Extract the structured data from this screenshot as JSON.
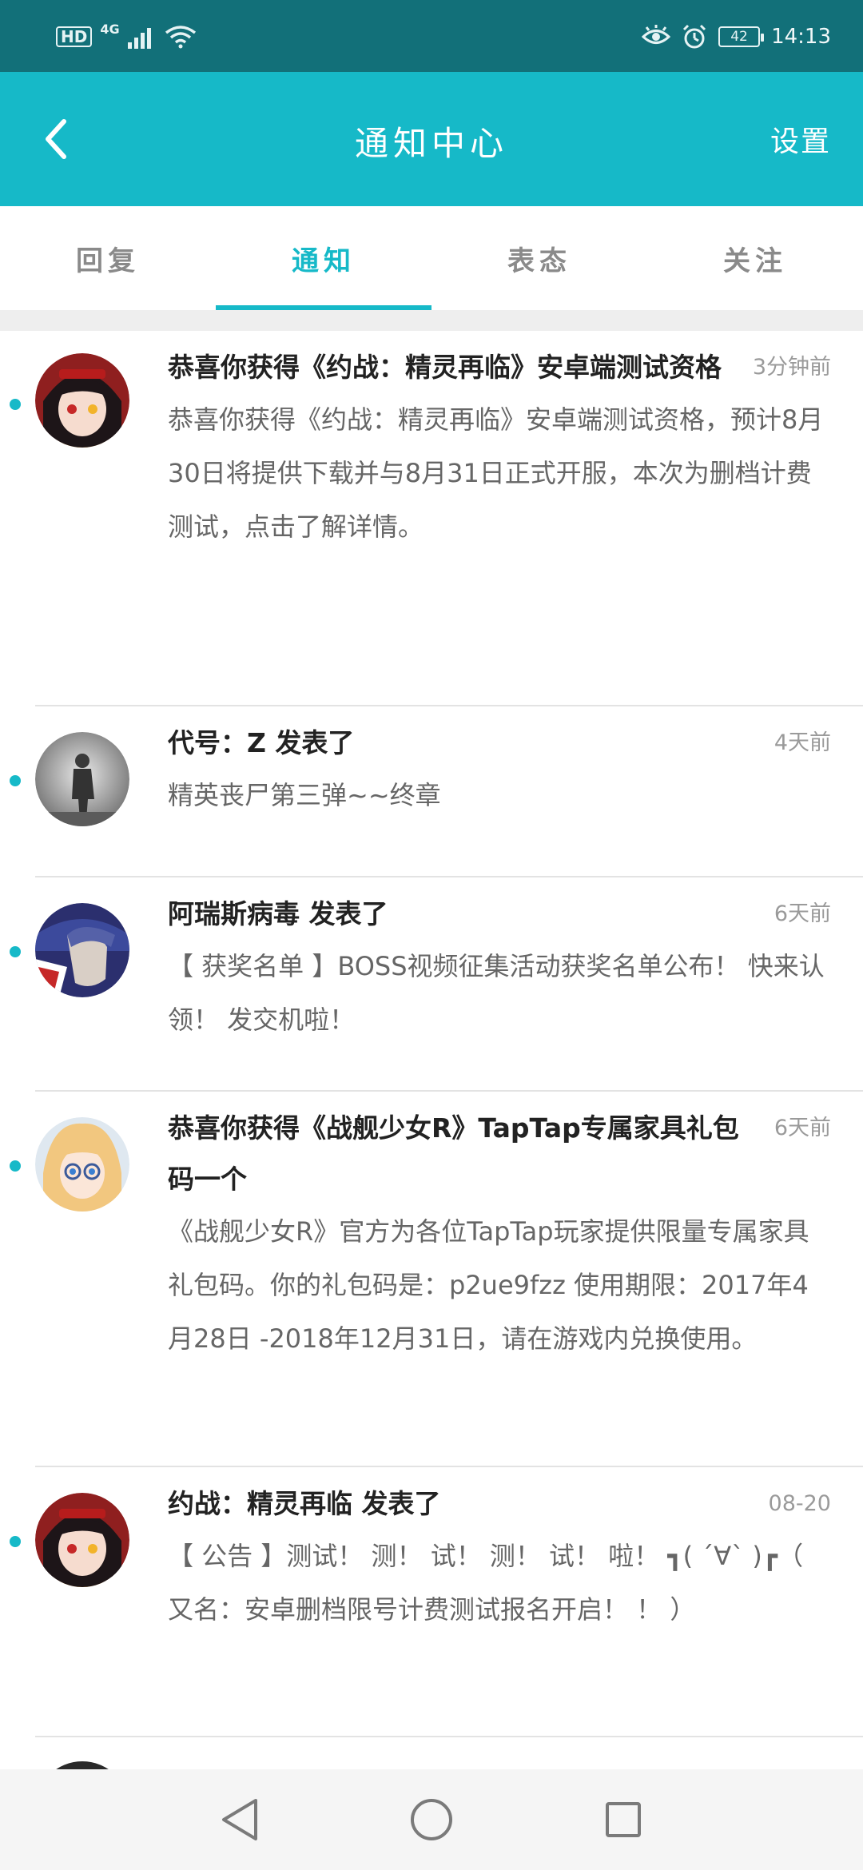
{
  "status_bar": {
    "hd": "HD",
    "network": "4G",
    "battery": "42",
    "time": "14:13"
  },
  "header": {
    "title": "通知中心",
    "settings": "设置"
  },
  "tabs": [
    {
      "label": "回复",
      "active": false
    },
    {
      "label": "通知",
      "active": true
    },
    {
      "label": "表态",
      "active": false
    },
    {
      "label": "关注",
      "active": false
    }
  ],
  "notifications": [
    {
      "title": "恭喜你获得《约战：精灵再临》安卓端测试资格",
      "time": "3分钟前",
      "body": "恭喜你获得《约战：精灵再临》安卓端测试资格，预计8月30日将提供下载并与8月31日正式开服，本次为删档计费测试，点击了解详情。",
      "avatar": "anime-girl-avatar"
    },
    {
      "title": "代号：Z 发表了",
      "time": "4天前",
      "body": "精英丧尸第三弹~~终章",
      "avatar": "zombie-figure-avatar"
    },
    {
      "title": "阿瑞斯病毒 发表了",
      "time": "6天前",
      "body": "【 获奖名单 】BOSS视频征集活动获奖名单公布！ 快来认领！ 发交机啦！",
      "avatar": "soldier-avatar"
    },
    {
      "title": "恭喜你获得《战舰少女R》TapTap专属家具礼包码一个",
      "time": "6天前",
      "body": "《战舰少女R》官方为各位TapTap玩家提供限量专属家具礼包码。你的礼包码是：p2ue9fzz 使用期限：2017年4月28日 -2018年12月31日，请在游戏内兑换使用。",
      "avatar": "blonde-girl-avatar"
    },
    {
      "title": "约战：精灵再临 发表了",
      "time": "08-20",
      "body": "【 公告 】测试！ 测！ 试！ 测！ 试！ 啦！ ┓( ´∀` )┏（ 又名：安卓删档限号计费测试报名开启！ ！ ）",
      "avatar": "anime-girl-avatar"
    }
  ]
}
